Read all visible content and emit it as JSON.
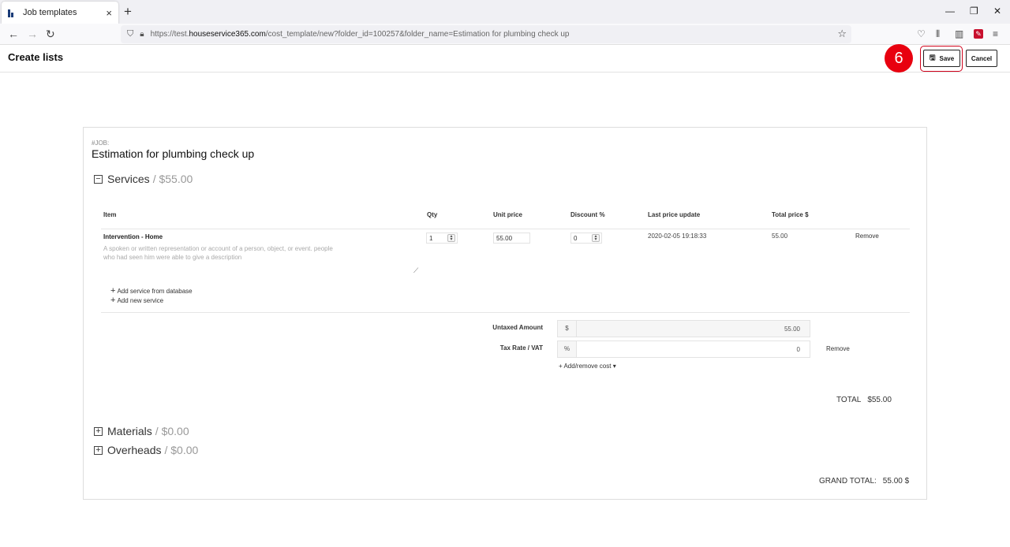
{
  "browser": {
    "tab_title": "Job templates",
    "tab_close": "×",
    "new_tab": "+",
    "url_prefix": "https://test.",
    "url_domain": "houseservice365.com",
    "url_rest": "/cost_template/new?folder_id=100257&folder_name=Estimation for plumbing check up"
  },
  "header": {
    "title": "Create lists",
    "step_number": "6",
    "save_label": "Save",
    "cancel_label": "Cancel"
  },
  "job": {
    "tag": "#JOB:",
    "name": "Estimation for plumbing check up"
  },
  "services": {
    "label": "Services",
    "amount": "/ $55.00",
    "toggle": "−",
    "columns": {
      "item": "Item",
      "qty": "Qty",
      "unit_price": "Unit price",
      "discount": "Discount %",
      "last_update": "Last price update",
      "total": "Total price $"
    },
    "row": {
      "name": "Intervention - Home",
      "description": "A spoken or written representation or account of a person, object, or event. people who had seen him were able to give a description",
      "qty": "1",
      "unit_price": "55.00",
      "discount": "0",
      "last_update": "2020-02-05 19:18:33",
      "total": "55.00",
      "remove": "Remove"
    },
    "add_from_db": "Add service from database",
    "add_new": "Add new service",
    "untaxed_label": "Untaxed Amount",
    "untaxed_prefix": "$",
    "untaxed_value": "55.00",
    "tax_label": "Tax Rate / VAT",
    "tax_prefix": "%",
    "tax_value": "0",
    "tax_remove": "Remove",
    "add_remove_cost": "+ Add/remove cost",
    "total_label": "TOTAL",
    "total_value": "$55.00"
  },
  "materials": {
    "label": "Materials",
    "amount": "/ $0.00",
    "toggle": "+"
  },
  "overheads": {
    "label": "Overheads",
    "amount": "/ $0.00",
    "toggle": "+"
  },
  "grand_total": {
    "label": "GRAND TOTAL:",
    "value": "55.00 $"
  },
  "colors": {
    "accent_red": "#e8000f",
    "border": "#dddddd"
  }
}
